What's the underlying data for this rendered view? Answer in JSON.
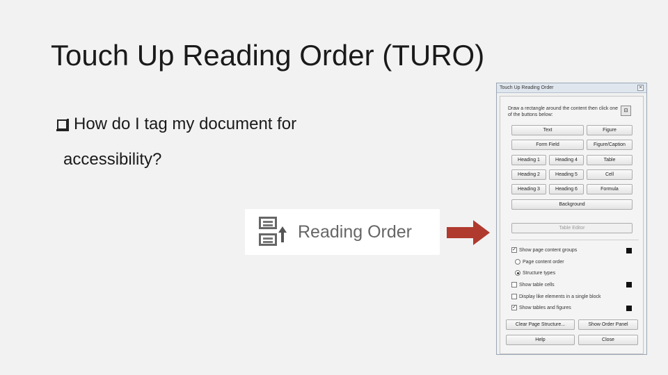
{
  "slide": {
    "title": "Touch Up Reading Order (TURO)",
    "bullet_line1": "How do I tag my document for",
    "bullet_line2": "accessibility?"
  },
  "reading_order_button": {
    "label": "Reading Order",
    "icon": "reading-order-icon"
  },
  "arrow_color": "#b03a2e",
  "dialog": {
    "title": "Touch Up Reading Order",
    "close": "✕",
    "instruction": "Draw a rectangle around the content then click one of the buttons below:",
    "buttons": {
      "text": "Text",
      "figure": "Figure",
      "form_field": "Form Field",
      "figure_caption": "Figure/Caption",
      "heading1": "Heading 1",
      "heading4": "Heading 4",
      "table": "Table",
      "heading2": "Heading 2",
      "heading5": "Heading 5",
      "cell": "Cell",
      "heading3": "Heading 3",
      "heading6": "Heading 6",
      "formula": "Formula",
      "background": "Background",
      "table_editor": "Table Editor",
      "clear_page_structure": "Clear Page Structure...",
      "show_order_panel": "Show Order Panel",
      "help": "Help",
      "close": "Close"
    },
    "options": {
      "show_page_content_groups": "Show page content groups",
      "page_content_order": "Page content order",
      "structure_types": "Structure types",
      "show_table_cells": "Show table cells",
      "display_like_elements": "Display like elements in a single block",
      "show_tables_and_figures": "Show tables and figures"
    },
    "check": "✓"
  }
}
